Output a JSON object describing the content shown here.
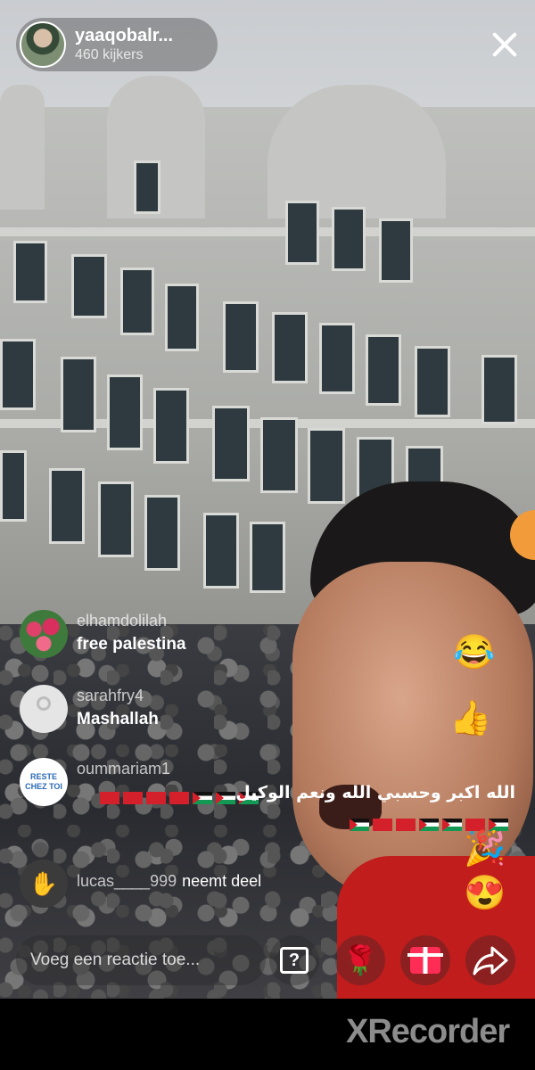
{
  "stream": {
    "host_name": "yaaqobalr...",
    "viewer_count": "460 kijkers",
    "close_icon": "close-icon"
  },
  "comments": [
    {
      "user": "elhamdolilah",
      "text": "free palestina",
      "avatar": "roses-avatar"
    },
    {
      "user": "sarahfry4",
      "text": "Mashallah",
      "avatar": "default-avatar"
    },
    {
      "user": "oummariam1",
      "text": "الله اكبر وحسبي الله ونعم الوكيل",
      "avatar": "reste-chez-toi-avatar",
      "avatar_text": "RESTE CHEZ TOI"
    }
  ],
  "join_event": {
    "user": "lucas____999",
    "text": "neemt deel",
    "avatar": "waving-hand-avatar"
  },
  "reactions": [
    "laughing-emoji",
    "thumbs-up-heart-eyes-emoji",
    "heart-eyes-emoji"
  ],
  "bottom_bar": {
    "comment_placeholder": "Voeg een reactie toe...",
    "buttons": [
      "question-icon",
      "rose-gift-icon",
      "gift-box-icon",
      "share-arrow-icon"
    ]
  },
  "watermark": {
    "brand": "XRecorder"
  },
  "colors": {
    "gift_pink": "#ff2d55",
    "shirt_red": "#c21d1d",
    "pill_bg": "rgba(80,80,80,0.45)"
  }
}
